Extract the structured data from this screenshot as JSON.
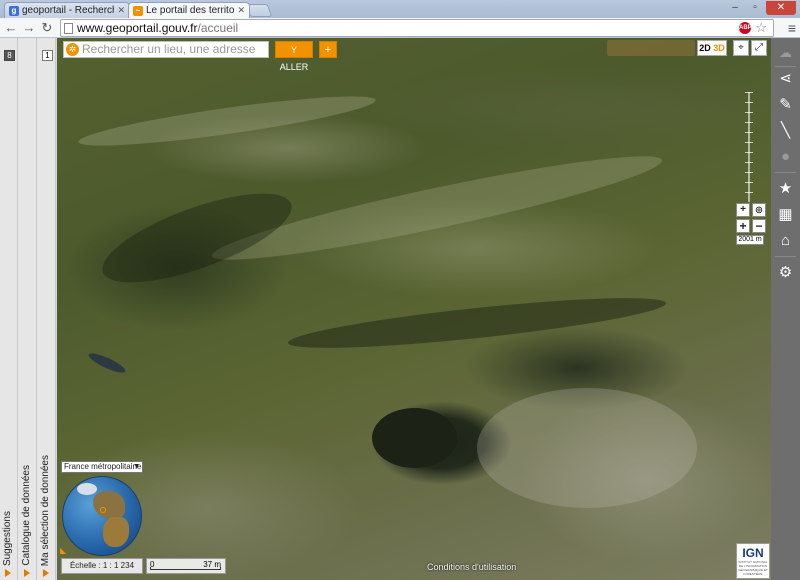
{
  "browser": {
    "tabs": [
      {
        "title": "geoportail - Recherche",
        "favicon": "google-icon",
        "active": false
      },
      {
        "title": "Le portail des territoires",
        "favicon": "geoportail-icon",
        "active": true
      }
    ],
    "url_host": "www.geoportail.gouv.fr",
    "url_path": "/accueil",
    "abp_label": "ABP"
  },
  "left_panel": {
    "col1_number": "8",
    "col2_number": "1",
    "suggestions_label": "Suggestions",
    "catalogue_label": "Catalogue de données",
    "selection_label": "Ma sélection de données"
  },
  "map": {
    "search_placeholder": "Rechercher un lieu, une adresse",
    "go_label": "Y ALLER",
    "plus_label": "+",
    "mode_2d": "2D",
    "mode_3d": "3D",
    "zoom_in": "+",
    "zoom_out": "−",
    "zoom_scale": "2001 m",
    "region": "France métropolitaine",
    "scale_text": "Échelle : 1 : 1 234",
    "scalebar_start": "0",
    "scalebar_end": "37 m",
    "conditions": "Conditions d'utilisation",
    "logo_text": "IGN",
    "logo_subtext": "INSTITUT NATIONAL DE L'INFORMATION GÉOGRAPHIQUE ET FORESTIÈRE"
  },
  "right_tools": [
    "share-icon",
    "pencil-icon",
    "measure-icon",
    "alert-icon",
    "star-icon",
    "map-icon",
    "house-icon",
    "gear-icon"
  ],
  "colors": {
    "accent": "#f29200",
    "sidebar": "#6e6e6e"
  }
}
